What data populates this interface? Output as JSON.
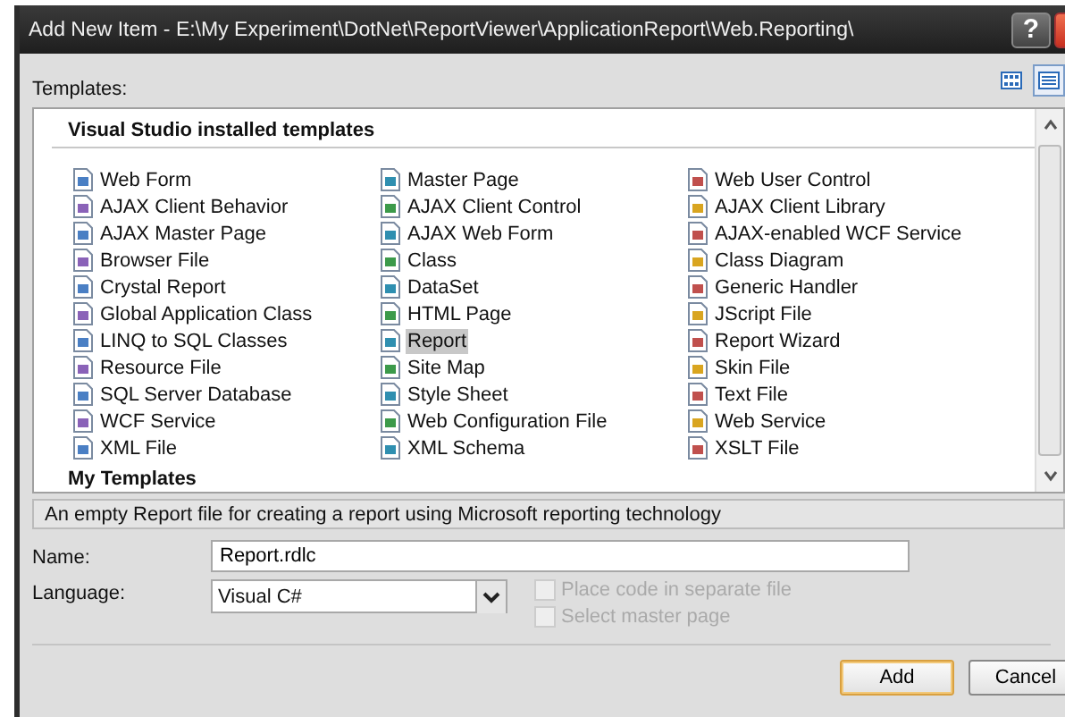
{
  "window": {
    "title": "Add New Item - E:\\My Experiment\\DotNet\\ReportViewer\\ApplicationReport\\Web.Reporting\\",
    "help": "?"
  },
  "view_buttons": [
    {
      "kind": "grid",
      "selected": false
    },
    {
      "kind": "list",
      "selected": true
    }
  ],
  "templates_label": "Templates:",
  "templates": {
    "section": "Visual Studio installed templates",
    "columns": [
      [
        {
          "label": "Web Form",
          "selected": false
        },
        {
          "label": "AJAX Client Behavior",
          "selected": false
        },
        {
          "label": "AJAX Master Page",
          "selected": false
        },
        {
          "label": "Browser File",
          "selected": false
        },
        {
          "label": "Crystal Report",
          "selected": false
        },
        {
          "label": "Global Application Class",
          "selected": false
        },
        {
          "label": "LINQ to SQL Classes",
          "selected": false
        },
        {
          "label": "Resource File",
          "selected": false
        },
        {
          "label": "SQL Server Database",
          "selected": false
        },
        {
          "label": "WCF Service",
          "selected": false
        },
        {
          "label": "XML File",
          "selected": false
        }
      ],
      [
        {
          "label": "Master Page",
          "selected": false
        },
        {
          "label": "AJAX Client Control",
          "selected": false
        },
        {
          "label": "AJAX Web Form",
          "selected": false
        },
        {
          "label": "Class",
          "selected": false
        },
        {
          "label": "DataSet",
          "selected": false
        },
        {
          "label": "HTML Page",
          "selected": false
        },
        {
          "label": "Report",
          "selected": true
        },
        {
          "label": "Site Map",
          "selected": false
        },
        {
          "label": "Style Sheet",
          "selected": false
        },
        {
          "label": "Web Configuration File",
          "selected": false
        },
        {
          "label": "XML Schema",
          "selected": false
        }
      ],
      [
        {
          "label": "Web User Control",
          "selected": false
        },
        {
          "label": "AJAX Client Library",
          "selected": false
        },
        {
          "label": "AJAX-enabled WCF Service",
          "selected": false
        },
        {
          "label": "Class Diagram",
          "selected": false
        },
        {
          "label": "Generic Handler",
          "selected": false
        },
        {
          "label": "JScript File",
          "selected": false
        },
        {
          "label": "Report Wizard",
          "selected": false
        },
        {
          "label": "Skin File",
          "selected": false
        },
        {
          "label": "Text File",
          "selected": false
        },
        {
          "label": "Web Service",
          "selected": false
        },
        {
          "label": "XSLT File",
          "selected": false
        }
      ]
    ],
    "my_section": "My Templates"
  },
  "description": "An empty Report file for creating a report using Microsoft reporting technology",
  "name": {
    "label": "Name:",
    "value": "Report.rdlc"
  },
  "language": {
    "label": "Language:",
    "value": "Visual C#"
  },
  "options": [
    {
      "label": "Place code in separate file",
      "checked": false,
      "disabled": true
    },
    {
      "label": "Select master page",
      "checked": false,
      "disabled": true
    }
  ],
  "buttons": [
    {
      "label": "Add",
      "default": true
    },
    {
      "label": "Cancel",
      "default": false
    }
  ]
}
